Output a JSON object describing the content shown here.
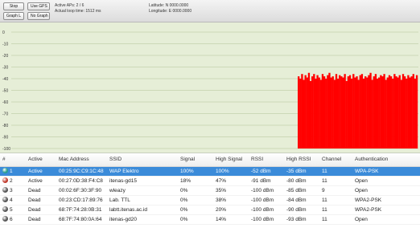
{
  "toolbar": {
    "stop_label": "Stop",
    "use_gps_label": "Use GPS",
    "graph_label": "Graph L",
    "no_graph_label": "No Graph",
    "active_aps": "Active APs: 2 / 6",
    "actual_loop_time": "Actual loop time: 1512 ms",
    "latitude": "Latitude: N 0000.0000",
    "longitude": "Longitude: E 0000.0000"
  },
  "colors": {
    "graph_bg": "#e6eed7",
    "gridline": "#c3d1ad",
    "signal_red": "#ff0000",
    "active_icon": "#2a9d8f",
    "active_icon_red": "#c0392b",
    "dead_icon": "#555555",
    "selection": "#3b8bd9"
  },
  "chart_data": {
    "type": "bar",
    "ylabel": "",
    "y_ticks": [
      "0",
      "-10",
      "-20",
      "-30",
      "-40",
      "-50",
      "-60",
      "-70",
      "-80",
      "-90",
      "-100"
    ],
    "ylim": [
      -100,
      0
    ],
    "grid": true,
    "series": [
      {
        "values": [
          -38,
          -40,
          -36,
          -41,
          -37,
          -39,
          -35,
          -42,
          -38,
          -36,
          -40,
          -37,
          -39,
          -41,
          -36,
          -38,
          -40,
          -37,
          -35,
          -39,
          -38,
          -41,
          -36,
          -40,
          -37,
          -38,
          -39,
          -36,
          -42,
          -38,
          -37,
          -40,
          -36,
          -39,
          -38,
          -41,
          -37,
          -36,
          -40,
          -38,
          -39,
          -37,
          -35,
          -41,
          -38,
          -36,
          -40,
          -39,
          -37,
          -38,
          -36,
          -41,
          -39,
          -37,
          -38,
          -40,
          -36,
          -38,
          -39,
          -37,
          -41,
          -36,
          -38,
          -40,
          -37,
          -39,
          -38,
          -36,
          -40,
          -37
        ]
      }
    ]
  },
  "table": {
    "columns": [
      "#",
      "Active",
      "Mac Address",
      "SSID",
      "Signal",
      "High Signal",
      "RSSI",
      "High RSSI",
      "Channel",
      "Authentication"
    ],
    "rows": [
      {
        "num": "1",
        "icon": "active-teal",
        "active": "Active",
        "mac": "00:25:9C:C9:1C:48",
        "ssid": "WAP Elektro",
        "signal": "100%",
        "high_signal": "100%",
        "rssi": "-52 dBm",
        "high_rssi": "-35 dBm",
        "channel": "11",
        "auth": "WPA-PSK"
      },
      {
        "num": "2",
        "icon": "active-red",
        "active": "Active",
        "mac": "00:27:0D:38:F4:C8",
        "ssid": "itenas-gd15",
        "signal": "18%",
        "high_signal": "47%",
        "rssi": "-91 dBm",
        "high_rssi": "-80 dBm",
        "channel": "11",
        "auth": "Open"
      },
      {
        "num": "3",
        "icon": "dead",
        "active": "Dead",
        "mac": "00:02:6F:30:3F:90",
        "ssid": "wleazy",
        "signal": "0%",
        "high_signal": "35%",
        "rssi": "-100 dBm",
        "high_rssi": "-85 dBm",
        "channel": "9",
        "auth": "Open"
      },
      {
        "num": "4",
        "icon": "dead",
        "active": "Dead",
        "mac": "00:23:CD:17:89:76",
        "ssid": "Lab. TTL",
        "signal": "0%",
        "high_signal": "38%",
        "rssi": "-100 dBm",
        "high_rssi": "-84 dBm",
        "channel": "11",
        "auth": "WPA2-PSK"
      },
      {
        "num": "5",
        "icon": "dead",
        "active": "Dead",
        "mac": "68:7F:74:28:0B:31",
        "ssid": "labtt.itenas.ac.id",
        "signal": "0%",
        "high_signal": "20%",
        "rssi": "-100 dBm",
        "high_rssi": "-90 dBm",
        "channel": "11",
        "auth": "WPA2-PSK"
      },
      {
        "num": "6",
        "icon": "dead",
        "active": "Dead",
        "mac": "68:7F:74:80:0A:64",
        "ssid": "itenas-gd20",
        "signal": "0%",
        "high_signal": "14%",
        "rssi": "-100 dBm",
        "high_rssi": "-93 dBm",
        "channel": "11",
        "auth": "Open"
      }
    ]
  }
}
